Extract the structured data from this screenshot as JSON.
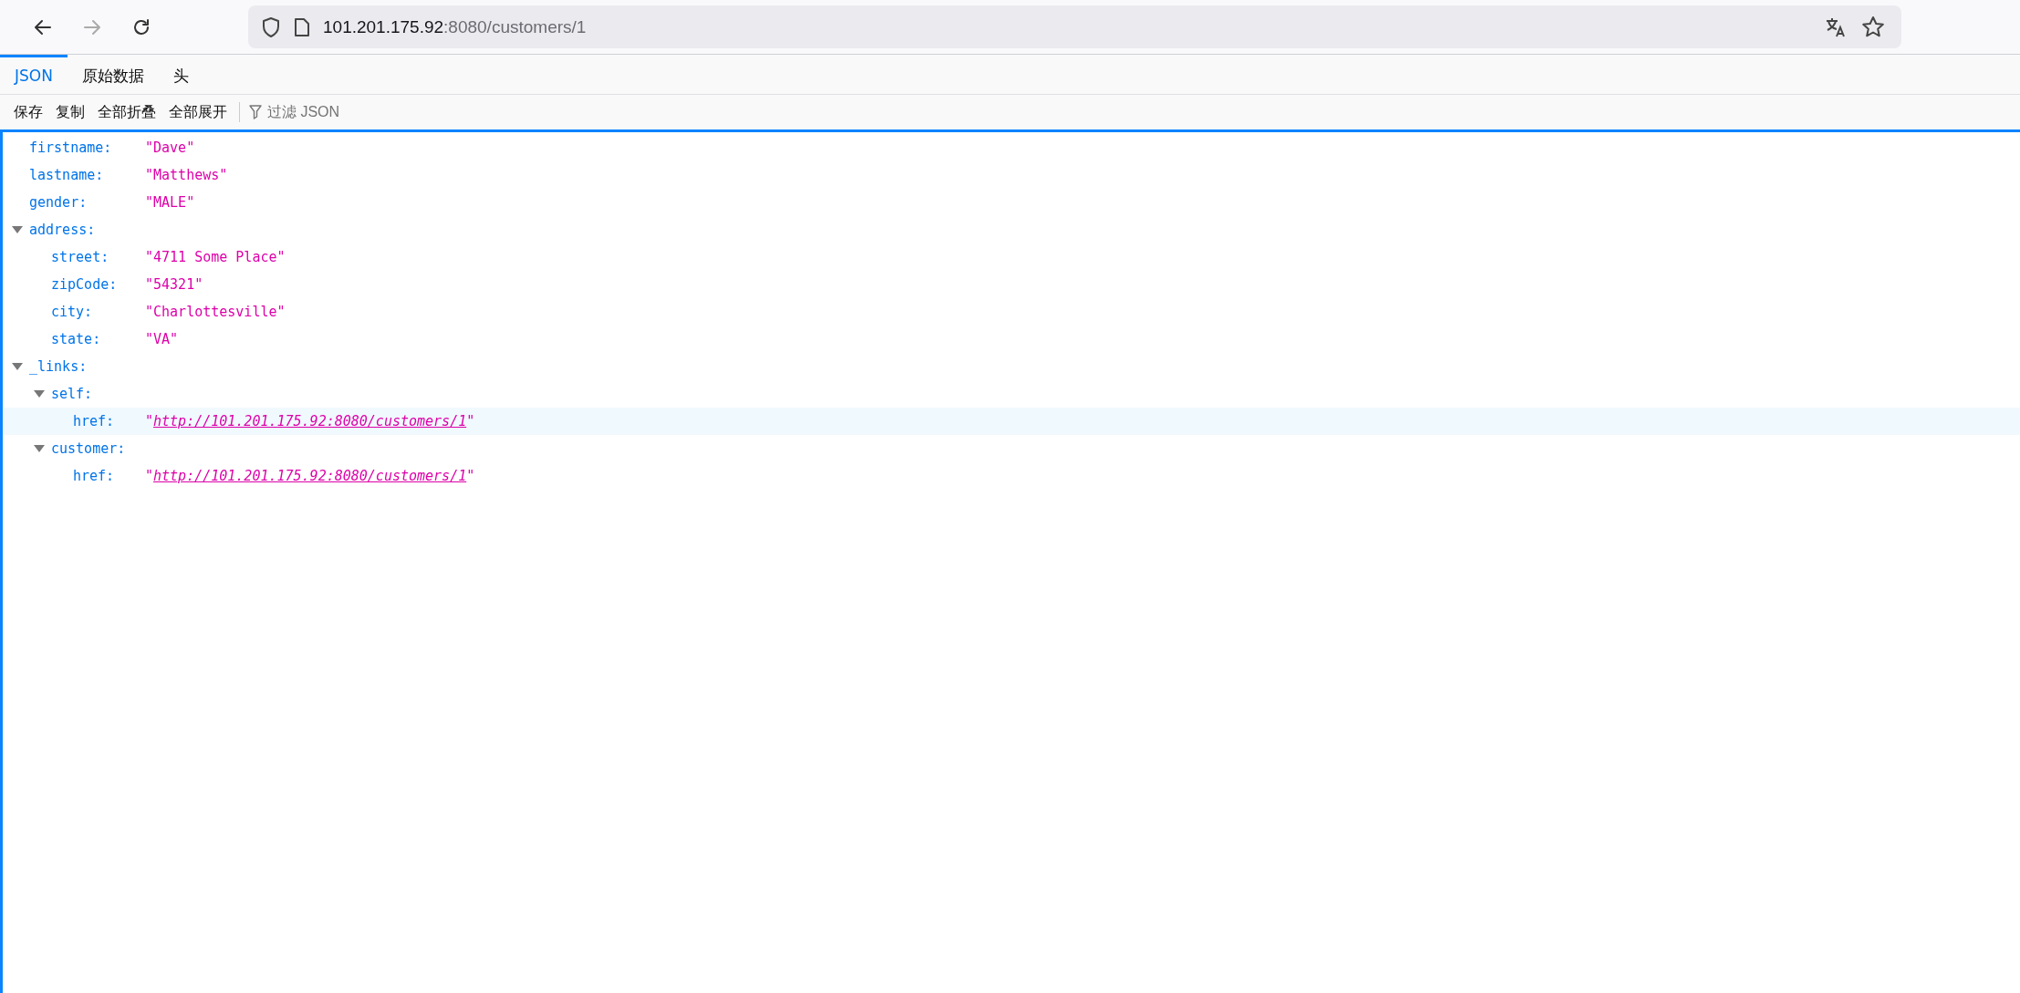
{
  "navbar": {
    "url_host": "101.201.175.92",
    "url_rest": ":8080/customers/1"
  },
  "tabs": [
    {
      "label": "JSON",
      "selected": true
    },
    {
      "label": "原始数据",
      "selected": false
    },
    {
      "label": "头",
      "selected": false
    }
  ],
  "toolbar": {
    "buttons": [
      "保存",
      "复制",
      "全部折叠",
      "全部展开"
    ],
    "filter": {
      "placeholder": "过滤 JSON"
    }
  },
  "tree": [
    {
      "key": "firstname:",
      "kind": "string",
      "value": "\"Dave\"",
      "selected": false
    },
    {
      "key": "lastname:",
      "kind": "string",
      "value": "\"Matthews\"",
      "selected": false
    },
    {
      "key": "gender:",
      "kind": "string",
      "value": "\"MALE\"",
      "selected": false
    },
    {
      "key": "address:",
      "kind": "object",
      "expanded": true,
      "selected": false,
      "children": [
        {
          "key": "street:",
          "kind": "string",
          "value": "\"4711 Some Place\"",
          "selected": false
        },
        {
          "key": "zipCode:",
          "kind": "string",
          "value": "\"54321\"",
          "selected": false
        },
        {
          "key": "city:",
          "kind": "string",
          "value": "\"Charlottesville\"",
          "selected": false
        },
        {
          "key": "state:",
          "kind": "string",
          "value": "\"VA\"",
          "selected": false
        }
      ]
    },
    {
      "key": "_links:",
      "kind": "object",
      "expanded": true,
      "selected": false,
      "children": [
        {
          "key": "self:",
          "kind": "object",
          "expanded": true,
          "selected": false,
          "children": [
            {
              "key": "href:",
              "kind": "link",
              "quote_open": "\"",
              "value": "http://101.201.175.92:8080/customers/1",
              "quote_close": "\"",
              "selected": true
            }
          ]
        },
        {
          "key": "customer:",
          "kind": "object",
          "expanded": true,
          "selected": false,
          "children": [
            {
              "key": "href:",
              "kind": "link",
              "quote_open": "\"",
              "value": "http://101.201.175.92:8080/customers/1",
              "quote_close": "\"",
              "selected": false
            }
          ]
        }
      ]
    }
  ]
}
